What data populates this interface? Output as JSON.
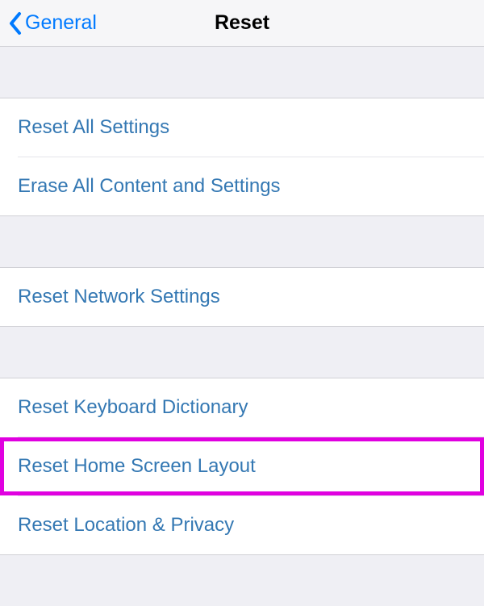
{
  "header": {
    "back_label": "General",
    "title": "Reset"
  },
  "groups": [
    {
      "rows": [
        {
          "label": "Reset All Settings"
        },
        {
          "label": "Erase All Content and Settings"
        }
      ]
    },
    {
      "rows": [
        {
          "label": "Reset Network Settings"
        }
      ]
    },
    {
      "rows": [
        {
          "label": "Reset Keyboard Dictionary"
        },
        {
          "label": "Reset Home Screen Layout",
          "highlighted": true
        },
        {
          "label": "Reset Location & Privacy"
        }
      ]
    }
  ]
}
